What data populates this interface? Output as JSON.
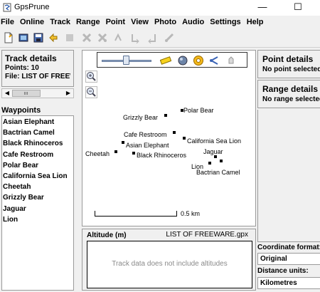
{
  "window": {
    "title": "GpsPrune",
    "minimize_glyph": "—",
    "maximize_glyph": "☐"
  },
  "menu": [
    "File",
    "Online",
    "Track",
    "Range",
    "Point",
    "View",
    "Photo",
    "Audio",
    "Settings",
    "Help"
  ],
  "toolbar": [
    "open-file-icon",
    "load-photos-icon",
    "save-icon",
    "undo-icon",
    "edit-point-icon",
    "delete-point-icon",
    "delete-range-icon",
    "set-range-start-icon",
    "set-range-end-icon",
    "connect-photo-icon"
  ],
  "track_details": {
    "title": "Track details",
    "points": "Points: 10",
    "file": "File: LIST OF FREEW..."
  },
  "waypoints": {
    "header": "Waypoints",
    "items": [
      "Asian Elephant",
      "Bactrian Camel",
      "Black Rhinoceros",
      "Cafe Restroom",
      "Polar Bear",
      "California Sea Lion",
      "Cheetah",
      "Grizzly Bear",
      "Jaguar",
      "Lion"
    ]
  },
  "map": {
    "zoom_in": "+",
    "zoom_out": "−",
    "scale_label": "0.5 km",
    "icons": [
      "scale-toggle-icon",
      "map-tiles-icon",
      "waypoint-toggle-icon",
      "connect-points-icon",
      "pan-icon"
    ],
    "labels": {
      "polar_bear": "Polar Bear",
      "grizzly_bear": "Grizzly Bear",
      "cafe_restroom": "Cafe Restroom",
      "california_sea_lion": "California Sea Lion",
      "asian_elephant": "Asian Elephant",
      "cheetah": "Cheetah",
      "black_rhinoceros": "Black Rhinoceros",
      "jaguar": "Jaguar",
      "lion": "Lion",
      "bactrian_camel": "Bactrian Camel"
    }
  },
  "altitude": {
    "title": "Altitude (m)",
    "file": "LIST OF FREEWARE.gpx",
    "message": "Track data does not include altitudes"
  },
  "point_details": {
    "title": "Point details",
    "status": "No point selected"
  },
  "range_details": {
    "title": "Range details",
    "status": "No range selected"
  },
  "settings": {
    "coord_label": "Coordinate format:",
    "coord_value": "Original",
    "distance_label": "Distance units:",
    "distance_value": "Kilometres"
  }
}
